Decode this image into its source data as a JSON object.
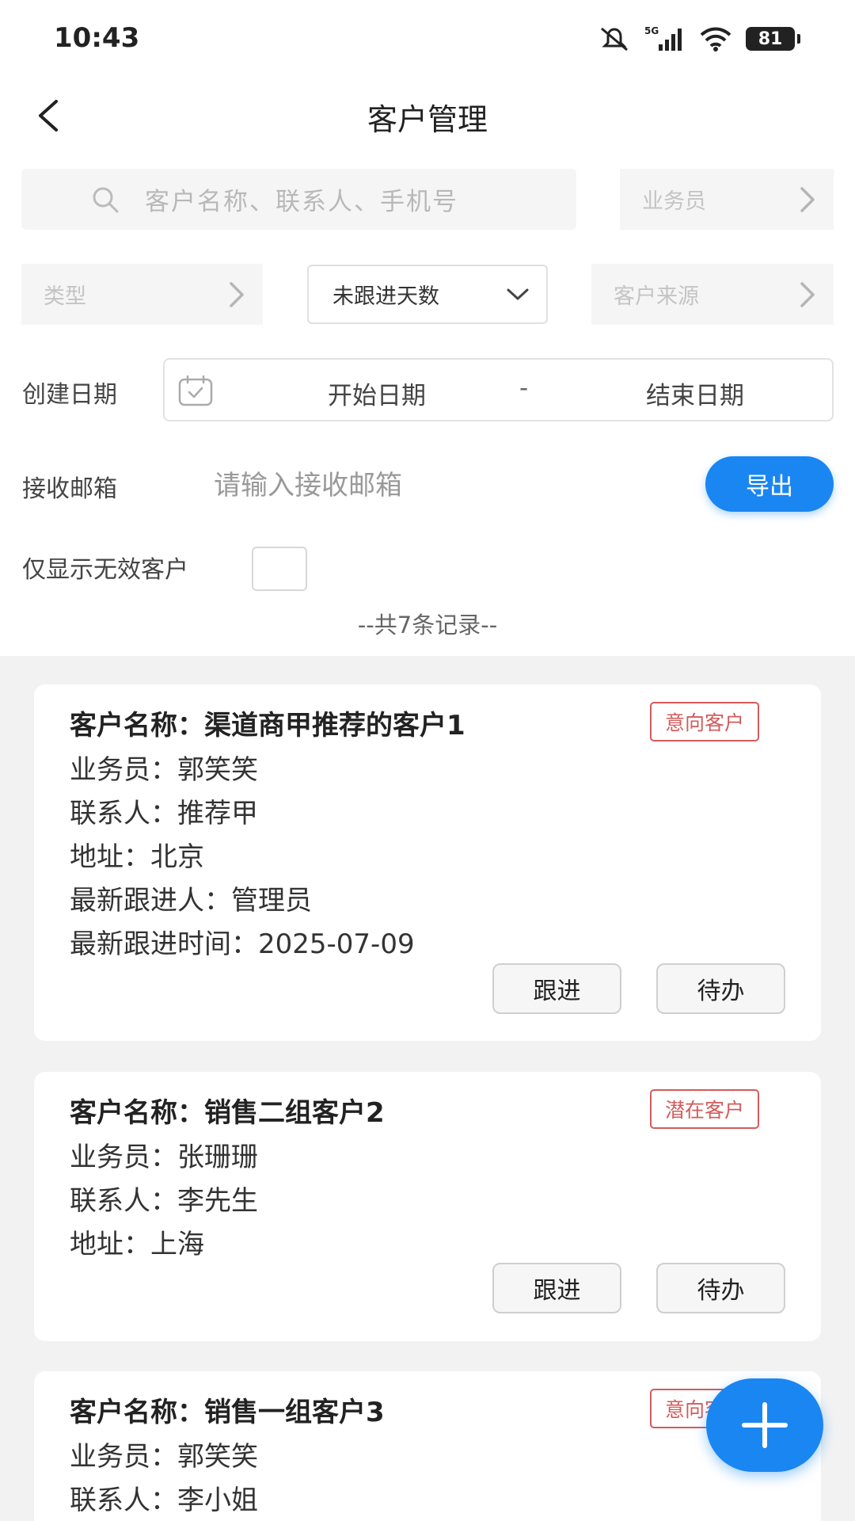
{
  "status_bar": {
    "time": "10:43",
    "network": "5G",
    "battery": "81"
  },
  "header": {
    "title": "客户管理",
    "back_icon": "chevron-left-icon"
  },
  "filters": {
    "search_placeholder": "客户名称、联系人、手机号",
    "salesperson_label": "业务员",
    "type_label": "类型",
    "days_dropdown_label": "未跟进天数",
    "source_label": "客户来源",
    "create_date_label": "创建日期",
    "start_date": "开始日期",
    "date_separator": "-",
    "end_date": "结束日期",
    "email_label": "接收邮箱",
    "email_placeholder": "请输入接收邮箱",
    "export_label": "导出",
    "invalid_only_label": "仅显示无效客户"
  },
  "record_count": "--共7条记录--",
  "customers": [
    {
      "name": "客户名称：渠道商甲推荐的客户1",
      "tag": "意向客户",
      "salesperson": "业务员：郭笑笑",
      "contact": "联系人：推荐甲",
      "address": "地址：北京",
      "latest_follower": "最新跟进人：管理员",
      "latest_follow_time": "最新跟进时间：2025-07-09"
    },
    {
      "name": "客户名称：销售二组客户2",
      "tag": "潜在客户",
      "salesperson": "业务员：张珊珊",
      "contact": "联系人：李先生",
      "address": "地址：上海"
    },
    {
      "name": "客户名称：销售一组客户3",
      "tag": "意向客户",
      "salesperson": "业务员：郭笑笑",
      "contact": "联系人：李小姐"
    }
  ],
  "card_actions": {
    "follow_up": "跟进",
    "todo": "待办"
  },
  "colors": {
    "primary": "#1a86f2",
    "tag_red": "#d35b5b",
    "list_bg": "#f2f2f2"
  }
}
